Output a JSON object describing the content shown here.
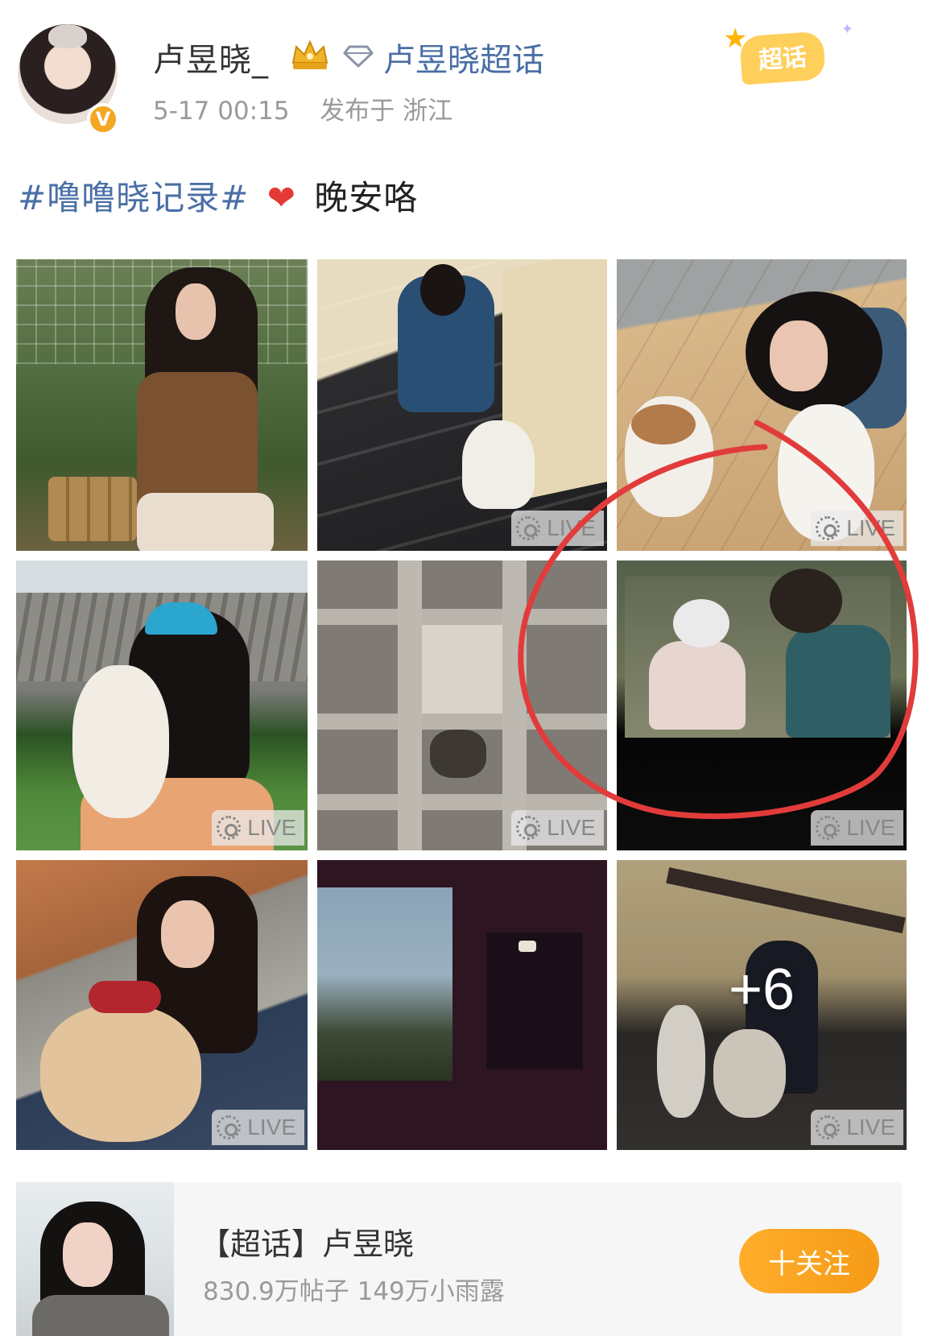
{
  "header": {
    "username": "卢昱晓_",
    "supertopic_link": "卢昱晓超话",
    "timestamp": "5-17 00:15",
    "location": "发布于 浙江",
    "badge_label": "超话"
  },
  "post": {
    "hashtag": "#噜噜晓记录#",
    "text": "晚安咯"
  },
  "photos": [
    {
      "live": ""
    },
    {
      "live": "LIVE"
    },
    {
      "live": "LIVE"
    },
    {
      "live": "LIVE"
    },
    {
      "live": "LIVE"
    },
    {
      "live": "LIVE"
    },
    {
      "live": "LIVE"
    },
    {
      "live": ""
    },
    {
      "live": "LIVE",
      "more": "+6"
    }
  ],
  "topic_card": {
    "title": "【超话】卢昱晓",
    "stats": "830.9万帖子 149万小雨露",
    "follow_label": "十关注"
  },
  "colors": {
    "link_blue": "#4a6fa5",
    "follow_orange": "#f59b17",
    "annotation_red": "#e23b3b"
  },
  "icons": [
    "verified-v-icon",
    "crown-badge-icon",
    "diamond-icon",
    "heart-emoji-icon",
    "live-photo-icon",
    "supertopic-badge-icon"
  ]
}
